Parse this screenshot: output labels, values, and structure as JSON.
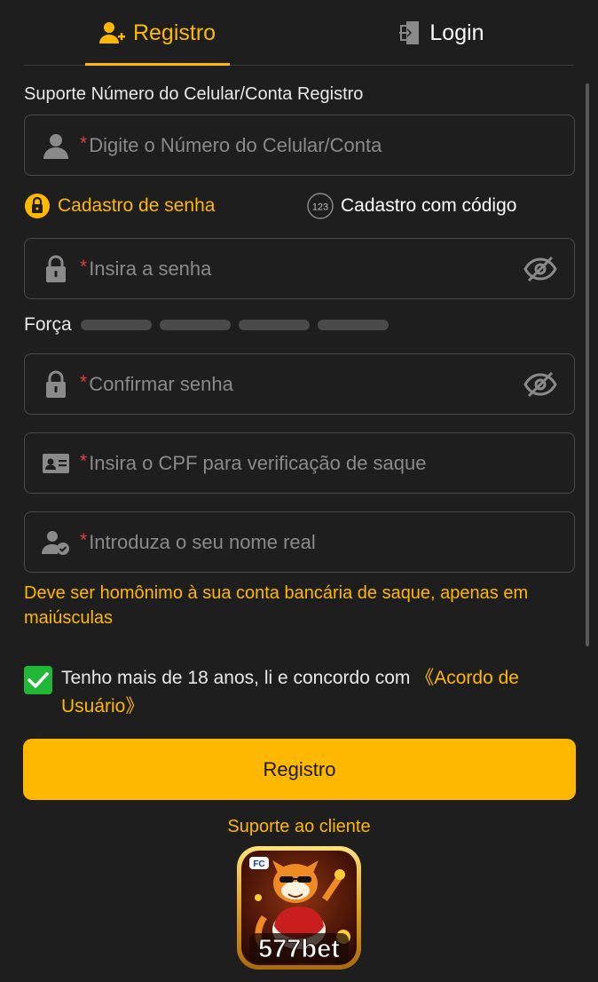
{
  "tabs": {
    "register": "Registro",
    "login": "Login"
  },
  "form": {
    "section_label": "Suporte Número do Celular/Conta Registro",
    "phone": {
      "star": "*",
      "placeholder": "Digite o Número do Celular/Conta",
      "icon": "user-icon"
    },
    "mode_password": "Cadastro de senha",
    "mode_code": "Cadastro com código",
    "mode_code_badge": "123",
    "password": {
      "star": "*",
      "placeholder": "Insira a senha",
      "icon": "lock-icon"
    },
    "strength_label": "Força",
    "confirm": {
      "star": "*",
      "placeholder": "Confirmar senha",
      "icon": "lock-icon"
    },
    "cpf": {
      "star": "*",
      "placeholder": "Insira o CPF para verificação de saque",
      "icon": "id-card-icon"
    },
    "realname": {
      "star": "*",
      "placeholder": "Introduza o seu nome real",
      "icon": "user-check-icon"
    },
    "hint": "Deve ser homônimo à sua conta bancária de saque, apenas em maiúsculas"
  },
  "agreement": {
    "checked": true,
    "text": "Tenho mais de 18 anos, li e concordo com ",
    "link": "《Acordo de Usuário》"
  },
  "submit_label": "Registro",
  "support_label": "Suporte ao cliente",
  "logo": {
    "brand": "577bet",
    "badge": "FC"
  },
  "colors": {
    "accent": "#ffb800",
    "background": "#1e1e1e",
    "border": "#4a4a4a",
    "required": "#e53e3e",
    "checkbox": "#21b837"
  }
}
